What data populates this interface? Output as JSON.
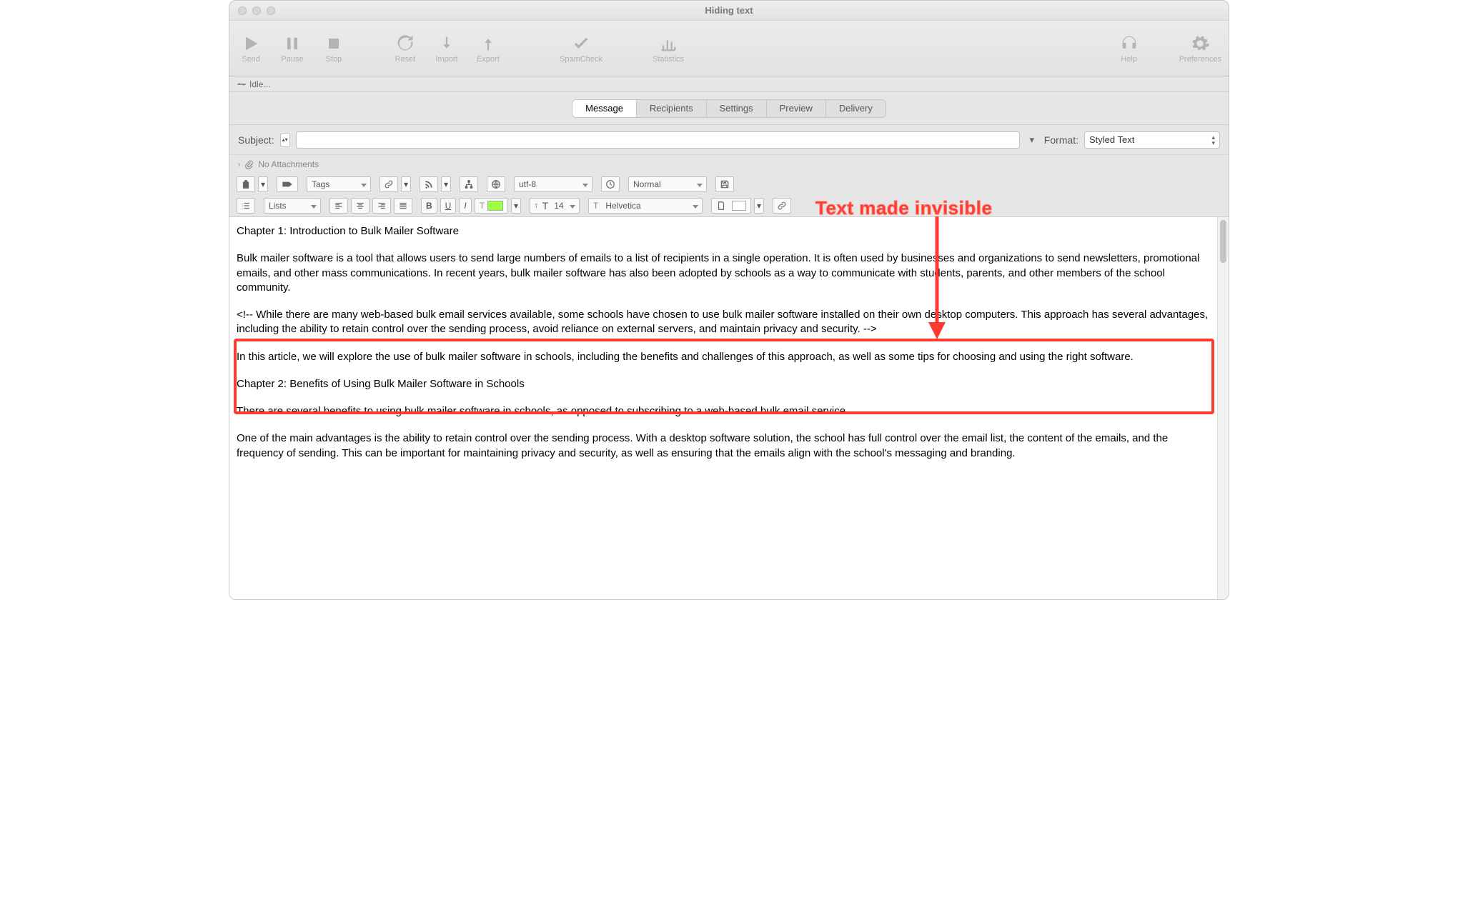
{
  "window": {
    "title": "Hiding text"
  },
  "toolbar": {
    "send": "Send",
    "pause": "Pause",
    "stop": "Stop",
    "reset": "Reset",
    "import": "Import",
    "export": "Export",
    "spamcheck": "SpamCheck",
    "statistics": "Statistics",
    "help": "Help",
    "preferences": "Preferences"
  },
  "status": {
    "text": "Idle..."
  },
  "tabs": {
    "message": "Message",
    "recipients": "Recipients",
    "settings": "Settings",
    "preview": "Preview",
    "delivery": "Delivery"
  },
  "subject": {
    "label": "Subject:",
    "value": "",
    "format_label": "Format:",
    "format_value": "Styled Text"
  },
  "attachments": {
    "label": "No Attachments"
  },
  "fmt": {
    "tags": "Tags",
    "encoding": "utf-8",
    "priority": "Normal",
    "lists": "Lists",
    "bold": "B",
    "underline": "U",
    "italic": "I",
    "textcolor_letter": "T",
    "fontsize_prefix": "₸T",
    "fontsize": "14",
    "fontfamily_prefix": "T",
    "fontfamily": "Helvetica"
  },
  "annotation": {
    "label": "Text made invisible"
  },
  "document": {
    "p1": "Chapter 1: Introduction to Bulk Mailer Software",
    "p2": "Bulk mailer software is a tool that allows users to send large numbers of emails to a list of recipients in a single operation. It is often used by businesses and organizations to send newsletters, promotional emails, and other mass communications. In recent years, bulk mailer software has also been adopted by schools as a way to communicate with students, parents, and other members of the school community.",
    "p3": "<!-- While there are many web-based bulk email services available, some schools have chosen to use bulk mailer software installed on their own desktop computers. This approach has several advantages, including the ability to retain control over the sending process, avoid reliance on external servers, and maintain privacy and security. -->",
    "p4": "In this article, we will explore the use of bulk mailer software in schools, including the benefits and challenges of this approach, as well as some tips for choosing and using the right software.",
    "p5": "Chapter 2: Benefits of Using Bulk Mailer Software in Schools",
    "p6": "There are several benefits to using bulk mailer software in schools, as opposed to subscribing to a web-based bulk email service.",
    "p7": "One of the main advantages is the ability to retain control over the sending process. With a desktop software solution, the school has full control over the email list, the content of the emails, and the frequency of sending. This can be important for maintaining privacy and security, as well as ensuring that the emails align with the school's messaging and branding."
  }
}
